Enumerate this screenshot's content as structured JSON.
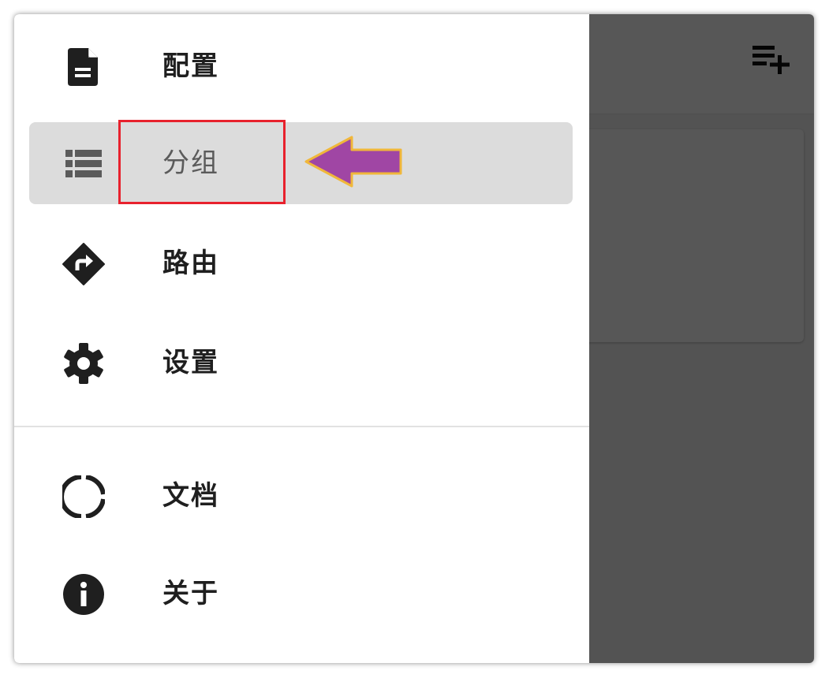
{
  "toolbar": {
    "add_icon": "playlist-add-icon"
  },
  "drawer": {
    "items": [
      {
        "label": "配置",
        "icon": "document-icon",
        "active": false
      },
      {
        "label": "分组",
        "icon": "list-icon",
        "active": true
      },
      {
        "label": "路由",
        "icon": "directions-icon",
        "active": false
      },
      {
        "label": "设置",
        "icon": "gear-icon",
        "active": false
      },
      {
        "label": "文档",
        "icon": "donut-icon",
        "active": false
      },
      {
        "label": "关于",
        "icon": "info-icon",
        "active": false
      }
    ]
  },
  "annotations": {
    "highlight_color": "#e8212d",
    "arrow_color": "#a046a4",
    "arrow_outline": "#f0b73a"
  },
  "colors": {
    "scrim": "#555555",
    "active_item_bg": "#dcdcdc",
    "icon": "#1f1f1f"
  }
}
